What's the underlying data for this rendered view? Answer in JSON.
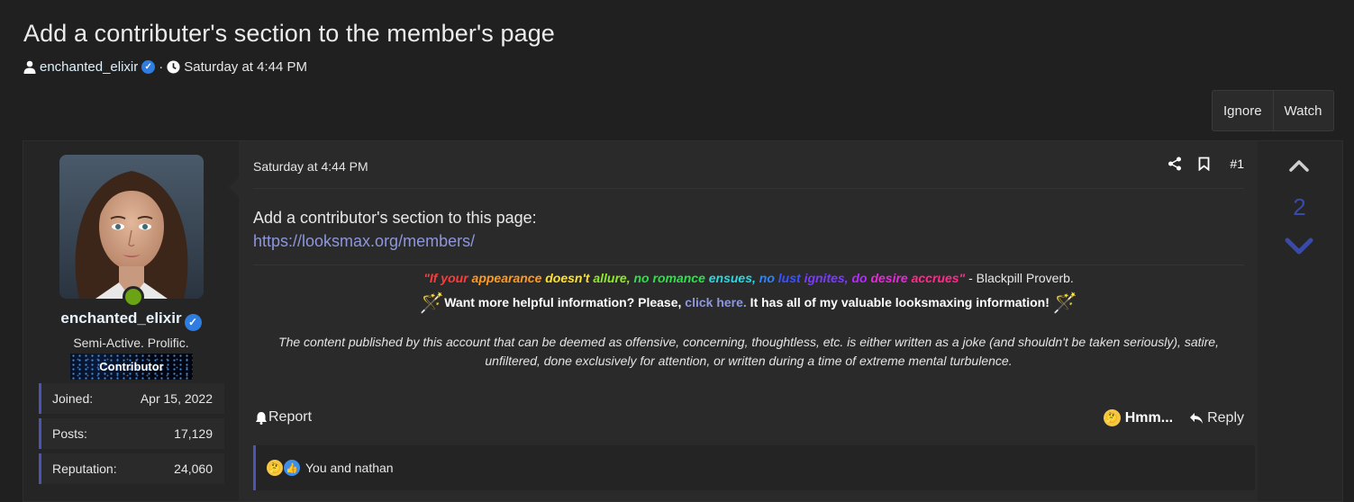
{
  "thread": {
    "title": "Add a contributer's section to the member's page",
    "author": "enchanted_elixir",
    "separator": "·",
    "date": "Saturday at 4:44 PM"
  },
  "actions": {
    "ignore": "Ignore",
    "watch": "Watch"
  },
  "user": {
    "name": "enchanted_elixir",
    "title": "Semi-Active. Prolific.",
    "banner": "Contributor",
    "stats": [
      {
        "label": "Joined:",
        "value": "Apr 15, 2022"
      },
      {
        "label": "Posts:",
        "value": "17,129"
      },
      {
        "label": "Reputation:",
        "value": "24,060"
      }
    ]
  },
  "post": {
    "date": "Saturday at 4:44 PM",
    "number": "#1",
    "body_line1": "Add a contributor's section to this page:",
    "body_link": "https://looksmax.org/members/"
  },
  "signature": {
    "quote_parts": [
      {
        "text": "\"If your ",
        "color": "#ff3b3b"
      },
      {
        "text": "appearance ",
        "color": "#ff9a1f"
      },
      {
        "text": "doesn't ",
        "color": "#ffe22a"
      },
      {
        "text": "allure, ",
        "color": "#8fe82a"
      },
      {
        "text": "no romance ",
        "color": "#2ee04a"
      },
      {
        "text": "ensues, ",
        "color": "#2ad7e0"
      },
      {
        "text": "no ",
        "color": "#2a86ff"
      },
      {
        "text": "lust ",
        "color": "#3a52ff"
      },
      {
        "text": "ignites, ",
        "color": "#7a3aff"
      },
      {
        "text": "do ",
        "color": "#b52aff"
      },
      {
        "text": "desire ",
        "color": "#e52ad8"
      },
      {
        "text": "accrues\"",
        "color": "#ff2a8a"
      }
    ],
    "attribution": " - Blackpill Proverb.",
    "info_before": "Want more helpful information? Please, ",
    "info_link": "click here.",
    "info_after": " It has all of my valuable looksmaxing information!",
    "wand": "🪄",
    "disclaimer_line1": "The content published by this account that can be deemed as offensive, concerning, thoughtless, etc. is either written as a joke (and shouldn't be taken seriously), satire,",
    "disclaimer_line2": "unfiltered, done exclusively for attention, or written during a time of extreme mental turbulence."
  },
  "footer": {
    "report": "Report",
    "hmm": "Hmm...",
    "reply": "Reply",
    "reactions_text": "You and nathan"
  },
  "votes": {
    "count": "2"
  },
  "colors": {
    "accent": "#4a55b5",
    "link": "#8e96de",
    "verified": "#2f7de1",
    "online": "#6aa314"
  },
  "icons": [
    "user-icon",
    "verified-icon",
    "clock-icon",
    "share-icon",
    "bookmark-icon",
    "bell-icon",
    "thinking-emoji-icon",
    "reply-icon",
    "like-emoji-icon",
    "arrow-up-icon",
    "arrow-down-icon",
    "wand-icon"
  ]
}
